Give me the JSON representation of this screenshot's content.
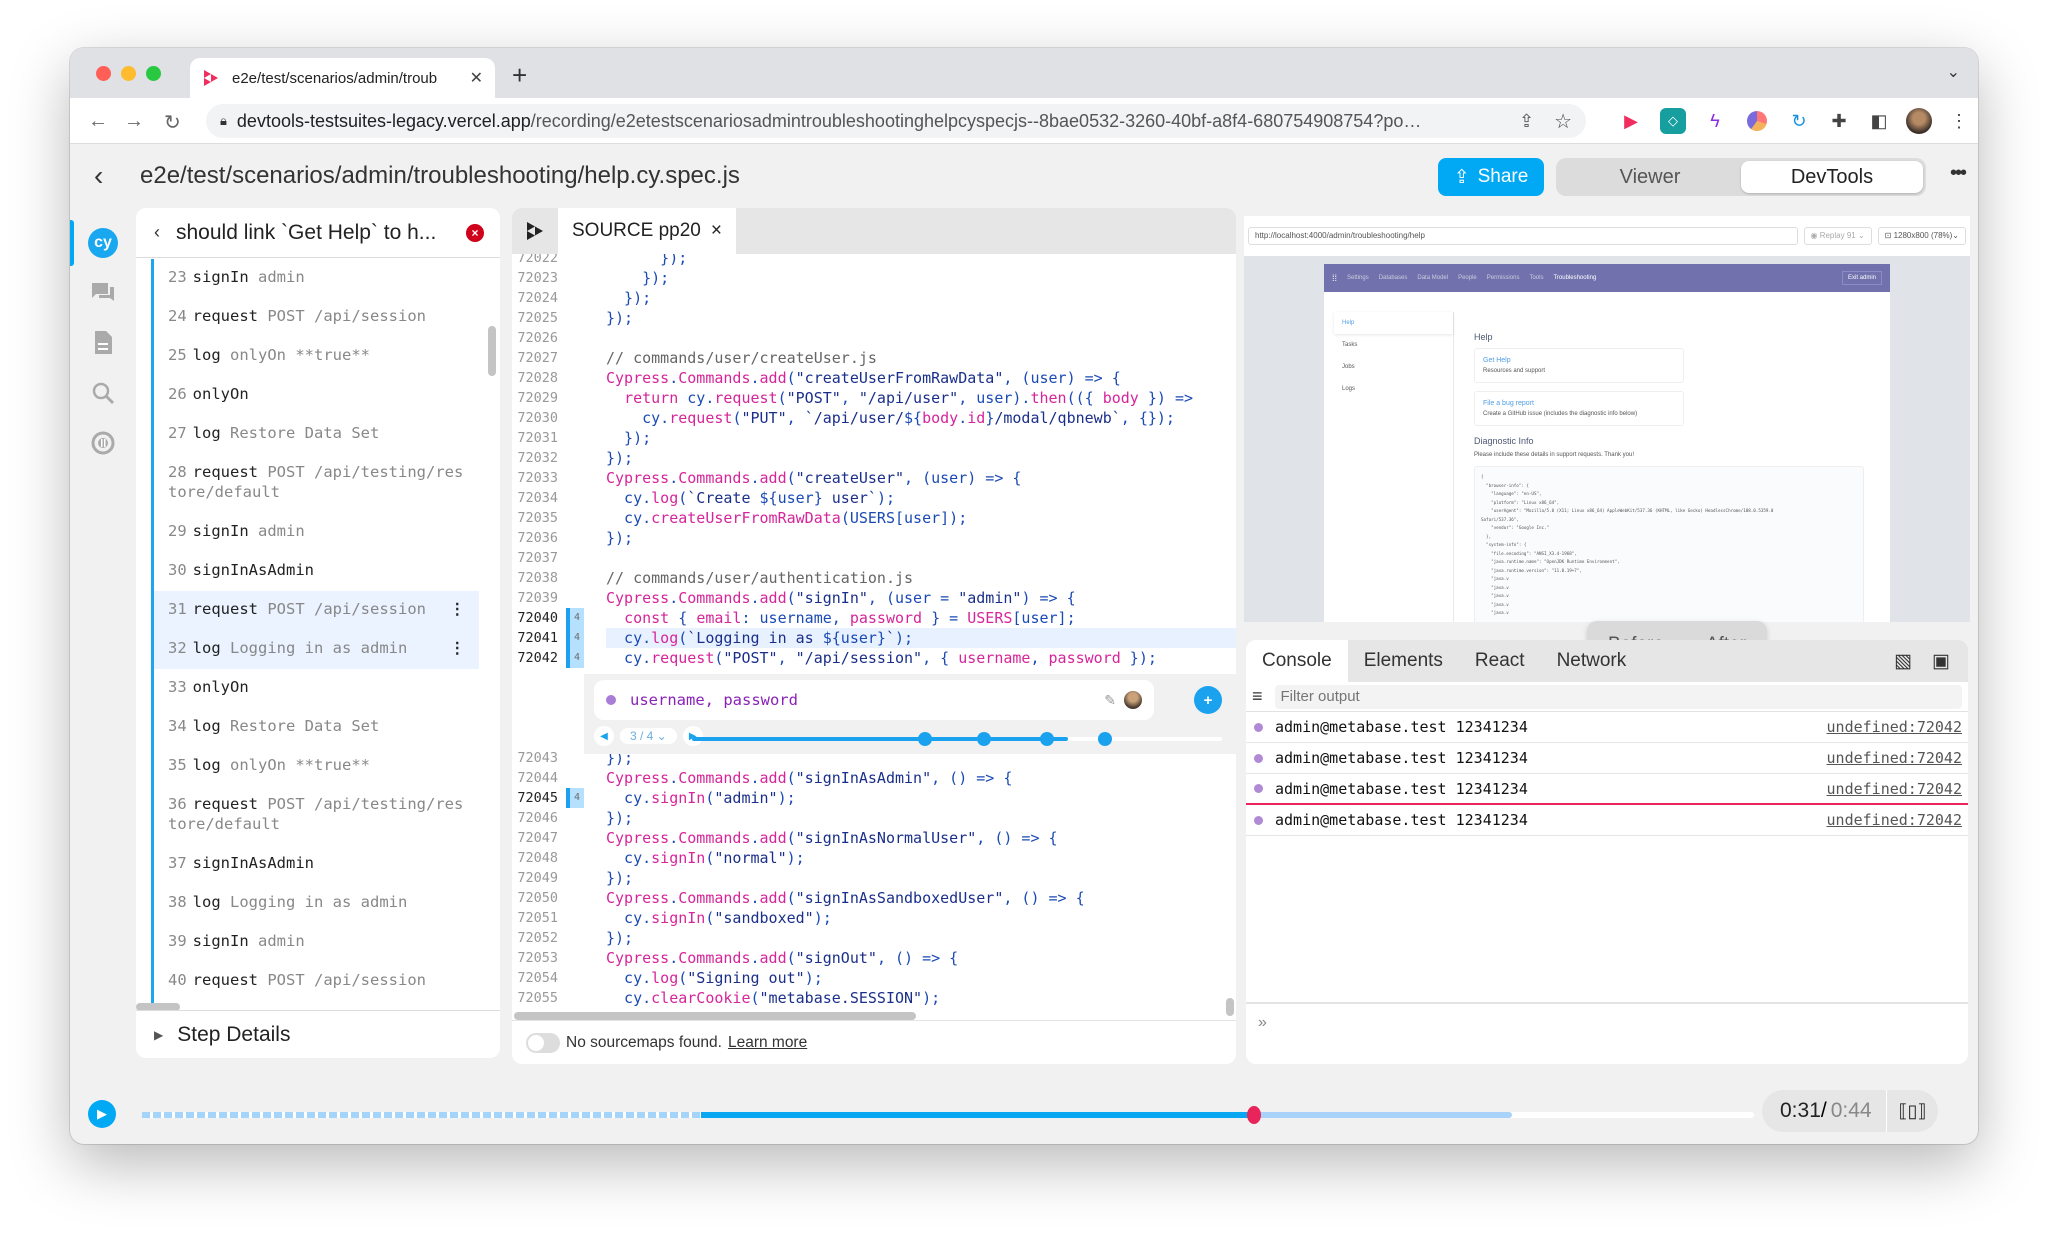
{
  "browser": {
    "tab_title": "e2e/test/scenarios/admin/troub",
    "url_host": "devtools-testsuites-legacy.vercel.app",
    "url_path": "/recording/e2etestscenariosadmintroubleshootinghelpcyspecjs--8bae0532-3260-40bf-a8f4-680754908754?po…",
    "new_tab": "+",
    "extensions": [
      "replay-extension",
      "bitwarden-extension",
      "lightning-extension",
      "figma-like-extension",
      "refresh-extension",
      "extensions-puzzle",
      "side-panel",
      "profile-avatar"
    ]
  },
  "header": {
    "back": "‹",
    "title": "e2e/test/scenarios/admin/troubleshooting/help.cy.spec.js",
    "share_label": "Share",
    "modes": [
      {
        "label": "Viewer",
        "active": false
      },
      {
        "label": "DevTools",
        "active": true
      }
    ],
    "more": "•••"
  },
  "rail": {
    "items": [
      "cypress-logo",
      "comments",
      "source",
      "search",
      "replay-info"
    ],
    "collapse": "«"
  },
  "test_panel": {
    "title": "should link `Get Help` to h...",
    "status": "failed",
    "steps": [
      {
        "num": "23",
        "cmd": "signIn",
        "arg": "admin",
        "selected": false
      },
      {
        "num": "24",
        "cmd": "request",
        "arg": "POST /api/session",
        "selected": false
      },
      {
        "num": "25",
        "cmd": "log",
        "arg": "onlyOn **true**",
        "selected": false
      },
      {
        "num": "26",
        "cmd": "onlyOn",
        "arg": "",
        "selected": false
      },
      {
        "num": "27",
        "cmd": "log",
        "arg": "Restore Data Set",
        "selected": false
      },
      {
        "num": "28",
        "cmd": "request",
        "arg": "POST /api/testing/restore/default",
        "selected": false
      },
      {
        "num": "29",
        "cmd": "signIn",
        "arg": "admin",
        "selected": false
      },
      {
        "num": "30",
        "cmd": "signInAsAdmin",
        "arg": "",
        "selected": false
      },
      {
        "num": "31",
        "cmd": "request",
        "arg": "POST /api/session",
        "selected": true
      },
      {
        "num": "32",
        "cmd": "log",
        "arg": "Logging in as admin",
        "selected": true
      },
      {
        "num": "33",
        "cmd": "onlyOn",
        "arg": "",
        "selected": false
      },
      {
        "num": "34",
        "cmd": "log",
        "arg": "Restore Data Set",
        "selected": false
      },
      {
        "num": "35",
        "cmd": "log",
        "arg": "onlyOn **true**",
        "selected": false
      },
      {
        "num": "36",
        "cmd": "request",
        "arg": "POST /api/testing/restore/default",
        "selected": false
      },
      {
        "num": "37",
        "cmd": "signInAsAdmin",
        "arg": "",
        "selected": false
      },
      {
        "num": "38",
        "cmd": "log",
        "arg": "Logging in as admin",
        "selected": false
      },
      {
        "num": "39",
        "cmd": "signIn",
        "arg": "admin",
        "selected": false
      },
      {
        "num": "40",
        "cmd": "request",
        "arg": "POST /api/session",
        "selected": false
      }
    ],
    "step_details_label": "Step Details"
  },
  "source": {
    "tab_label": "SOURCE pp20",
    "close": "×",
    "lines_before": [
      {
        "no": "72022",
        "hits": "",
        "html": "      });"
      },
      {
        "no": "72023",
        "hits": "",
        "html": "    });"
      },
      {
        "no": "72024",
        "hits": "",
        "html": "  });"
      },
      {
        "no": "72025",
        "hits": "",
        "html": "});"
      },
      {
        "no": "72026",
        "hits": "",
        "html": ""
      },
      {
        "no": "72027",
        "hits": "",
        "html": "<span class='c-cm'>// commands/user/createUser.js</span>"
      },
      {
        "no": "72028",
        "hits": "",
        "html": "<span class='c-kw'>Cypress</span>.<span class='c-kw'>Commands</span>.<span class='c-kw'>add</span>(<span class='c-str'>\"createUserFromRawData\"</span>, (user) => {"
      },
      {
        "no": "72029",
        "hits": "",
        "html": "  <span class='c-kw'>return</span> cy.<span class='c-kw'>request</span>(<span class='c-str'>\"POST\"</span>, <span class='c-str'>\"/api/user\"</span>, user).<span class='c-kw'>then</span>(({ <span class='c-kw'>body</span> }) =>"
      },
      {
        "no": "72030",
        "hits": "",
        "html": "    cy.<span class='c-kw'>request</span>(<span class='c-str'>\"PUT\"</span>, <span class='c-str'>`/api/user/</span>${<span class='c-kw'>body</span>.<span class='c-kw'>id</span>}<span class='c-str'>/modal/qbnewb`</span>, {});"
      },
      {
        "no": "72031",
        "hits": "",
        "html": "  });"
      },
      {
        "no": "72032",
        "hits": "",
        "html": "});"
      },
      {
        "no": "72033",
        "hits": "",
        "html": "<span class='c-kw'>Cypress</span>.<span class='c-kw'>Commands</span>.<span class='c-kw'>add</span>(<span class='c-str'>\"createUser\"</span>, (user) => {"
      },
      {
        "no": "72034",
        "hits": "",
        "html": "  cy.<span class='c-kw'>log</span>(<span class='c-str'>`Create </span>${user}<span class='c-str'> user`</span>);"
      },
      {
        "no": "72035",
        "hits": "",
        "html": "  cy.<span class='c-kw'>createUserFromRawData</span>(USERS[user]);"
      },
      {
        "no": "72036",
        "hits": "",
        "html": "});"
      },
      {
        "no": "72037",
        "hits": "",
        "html": ""
      },
      {
        "no": "72038",
        "hits": "",
        "html": "<span class='c-cm'>// commands/user/authentication.js</span>"
      },
      {
        "no": "72039",
        "hits": "",
        "html": "<span class='c-kw'>Cypress</span>.<span class='c-kw'>Commands</span>.<span class='c-kw'>add</span>(<span class='c-str'>\"signIn\"</span>, (user = <span class='c-str'>\"admin\"</span>) => {"
      },
      {
        "no": "72040",
        "hits": "4",
        "html": "  <span class='c-kw'>const</span> { <span class='c-kw'>email</span>: username, <span class='c-kw'>password</span> } = <span class='c-kw'>USERS</span>[user];"
      },
      {
        "no": "72041",
        "hits": "4",
        "current": true,
        "html": "  cy.<span class='c-kw'>log</span>(<span class='c-str'>`Logging in as </span>${user}<span class='c-str'>`</span>);"
      },
      {
        "no": "72042",
        "hits": "4",
        "html": "  cy.<span class='c-kw'>request</span>(<span class='c-str'>\"POST\"</span>, <span class='c-str'>\"/api/session\"</span>, { <span class='c-kw'>username</span>, <span class='c-kw'>password</span> });"
      }
    ],
    "lines_after": [
      {
        "no": "72043",
        "hits": "",
        "html": "});"
      },
      {
        "no": "72044",
        "hits": "",
        "html": "<span class='c-kw'>Cypress</span>.<span class='c-kw'>Commands</span>.<span class='c-kw'>add</span>(<span class='c-str'>\"signInAsAdmin\"</span>, () => {"
      },
      {
        "no": "72045",
        "hits": "4",
        "html": "  cy.<span class='c-kw'>signIn</span>(<span class='c-str'>\"admin\"</span>);"
      },
      {
        "no": "72046",
        "hits": "",
        "html": "});"
      },
      {
        "no": "72047",
        "hits": "",
        "html": "<span class='c-kw'>Cypress</span>.<span class='c-kw'>Commands</span>.<span class='c-kw'>add</span>(<span class='c-str'>\"signInAsNormalUser\"</span>, () => {"
      },
      {
        "no": "72048",
        "hits": "",
        "html": "  cy.<span class='c-kw'>signIn</span>(<span class='c-str'>\"normal\"</span>);"
      },
      {
        "no": "72049",
        "hits": "",
        "html": "});"
      },
      {
        "no": "72050",
        "hits": "",
        "html": "<span class='c-kw'>Cypress</span>.<span class='c-kw'>Commands</span>.<span class='c-kw'>add</span>(<span class='c-str'>\"signInAsSandboxedUser\"</span>, () => {"
      },
      {
        "no": "72051",
        "hits": "",
        "html": "  cy.<span class='c-kw'>signIn</span>(<span class='c-str'>\"sandboxed\"</span>);"
      },
      {
        "no": "72052",
        "hits": "",
        "html": "});"
      },
      {
        "no": "72053",
        "hits": "",
        "html": "<span class='c-kw'>Cypress</span>.<span class='c-kw'>Commands</span>.<span class='c-kw'>add</span>(<span class='c-str'>\"signOut\"</span>, () => {"
      },
      {
        "no": "72054",
        "hits": "",
        "html": "  cy.<span class='c-kw'>log</span>(<span class='c-str'>\"Signing out\"</span>);"
      },
      {
        "no": "72055",
        "hits": "",
        "html": "  cy.<span class='c-kw'>clearCookie</span>(<span class='c-str'>\"metabase.SESSION\"</span>);"
      }
    ],
    "print_widget": {
      "expression": "username, password",
      "counter": "3 / 4 ⌄",
      "hit_positions": [
        0.44,
        0.55,
        0.67,
        0.78
      ],
      "current_hit": 3,
      "total_hits": 4
    },
    "footer": {
      "sourcemaps_text": "No sourcemaps found.",
      "learn_more": "Learn more"
    }
  },
  "viewer": {
    "url": "http://localhost:4000/admin/troubleshooting/help",
    "replay_pill": "◉ Replay 91 ⌄",
    "size_pill": "⊡ 1280x800 (78%)⌄",
    "app_nav": [
      "Settings",
      "Databases",
      "Data Model",
      "People",
      "Permissions",
      "Tools",
      "Troubleshooting"
    ],
    "app_nav_active": "Troubleshooting",
    "exit_admin": "Exit admin",
    "side_items": [
      "Help",
      "Tasks",
      "Jobs",
      "Logs"
    ],
    "help_heading": "Help",
    "cards": [
      {
        "title": "Get Help",
        "desc": "Resources and support"
      },
      {
        "title": "File a bug report",
        "desc": "Create a GitHub issue (includes the diagnostic info below)"
      }
    ],
    "diag_heading": "Diagnostic Info",
    "diag_desc": "Please include these details in support requests. Thank you!",
    "diag_code": "{\n  \"browser-info\": {\n    \"language\": \"en-US\",\n    \"platform\": \"Linux x86_64\",\n    \"userAgent\": \"Mozilla/5.0 (X11; Linux x86_64) AppleWebKit/537.36 (KHTML, like Gecko) HeadlessChrome/108.0.5359.0\nSafari/537.36\",\n    \"vendor\": \"Google Inc.\"\n  },\n  \"system-info\": {\n    \"file.encoding\": \"ANSI_X3.4-1968\",\n    \"java.runtime.name\": \"OpenJDK Runtime Environment\",\n    \"java.runtime.version\": \"11.0.19+7\",\n    \"java.v\n    \"java.v\n    \"java.v\n    \"java.v\n    \"java.v",
    "before_label": "Before",
    "after_label": "After"
  },
  "devtools": {
    "tabs": [
      {
        "label": "Console",
        "active": true
      },
      {
        "label": "Elements",
        "active": false
      },
      {
        "label": "React",
        "active": false
      },
      {
        "label": "Network",
        "active": false
      }
    ],
    "filter_placeholder": "Filter output",
    "messages": [
      {
        "text": "admin@metabase.test 12341234",
        "source": "undefined:72042",
        "marked": false
      },
      {
        "text": "admin@metabase.test 12341234",
        "source": "undefined:72042",
        "marked": false
      },
      {
        "text": "admin@metabase.test 12341234",
        "source": "undefined:72042",
        "marked": true
      },
      {
        "text": "admin@metabase.test 12341234",
        "source": "undefined:72042",
        "marked": false
      }
    ],
    "prompt": "»"
  },
  "timeline": {
    "current": "0:31",
    "separator": " / ",
    "total": "0:44",
    "progress": 0.69,
    "focus_start": 0.347,
    "focus_end": 0.85,
    "colors": {
      "accent": "#01a9f4",
      "playhead": "#e8245a",
      "print_value": "#8a22b8"
    }
  }
}
